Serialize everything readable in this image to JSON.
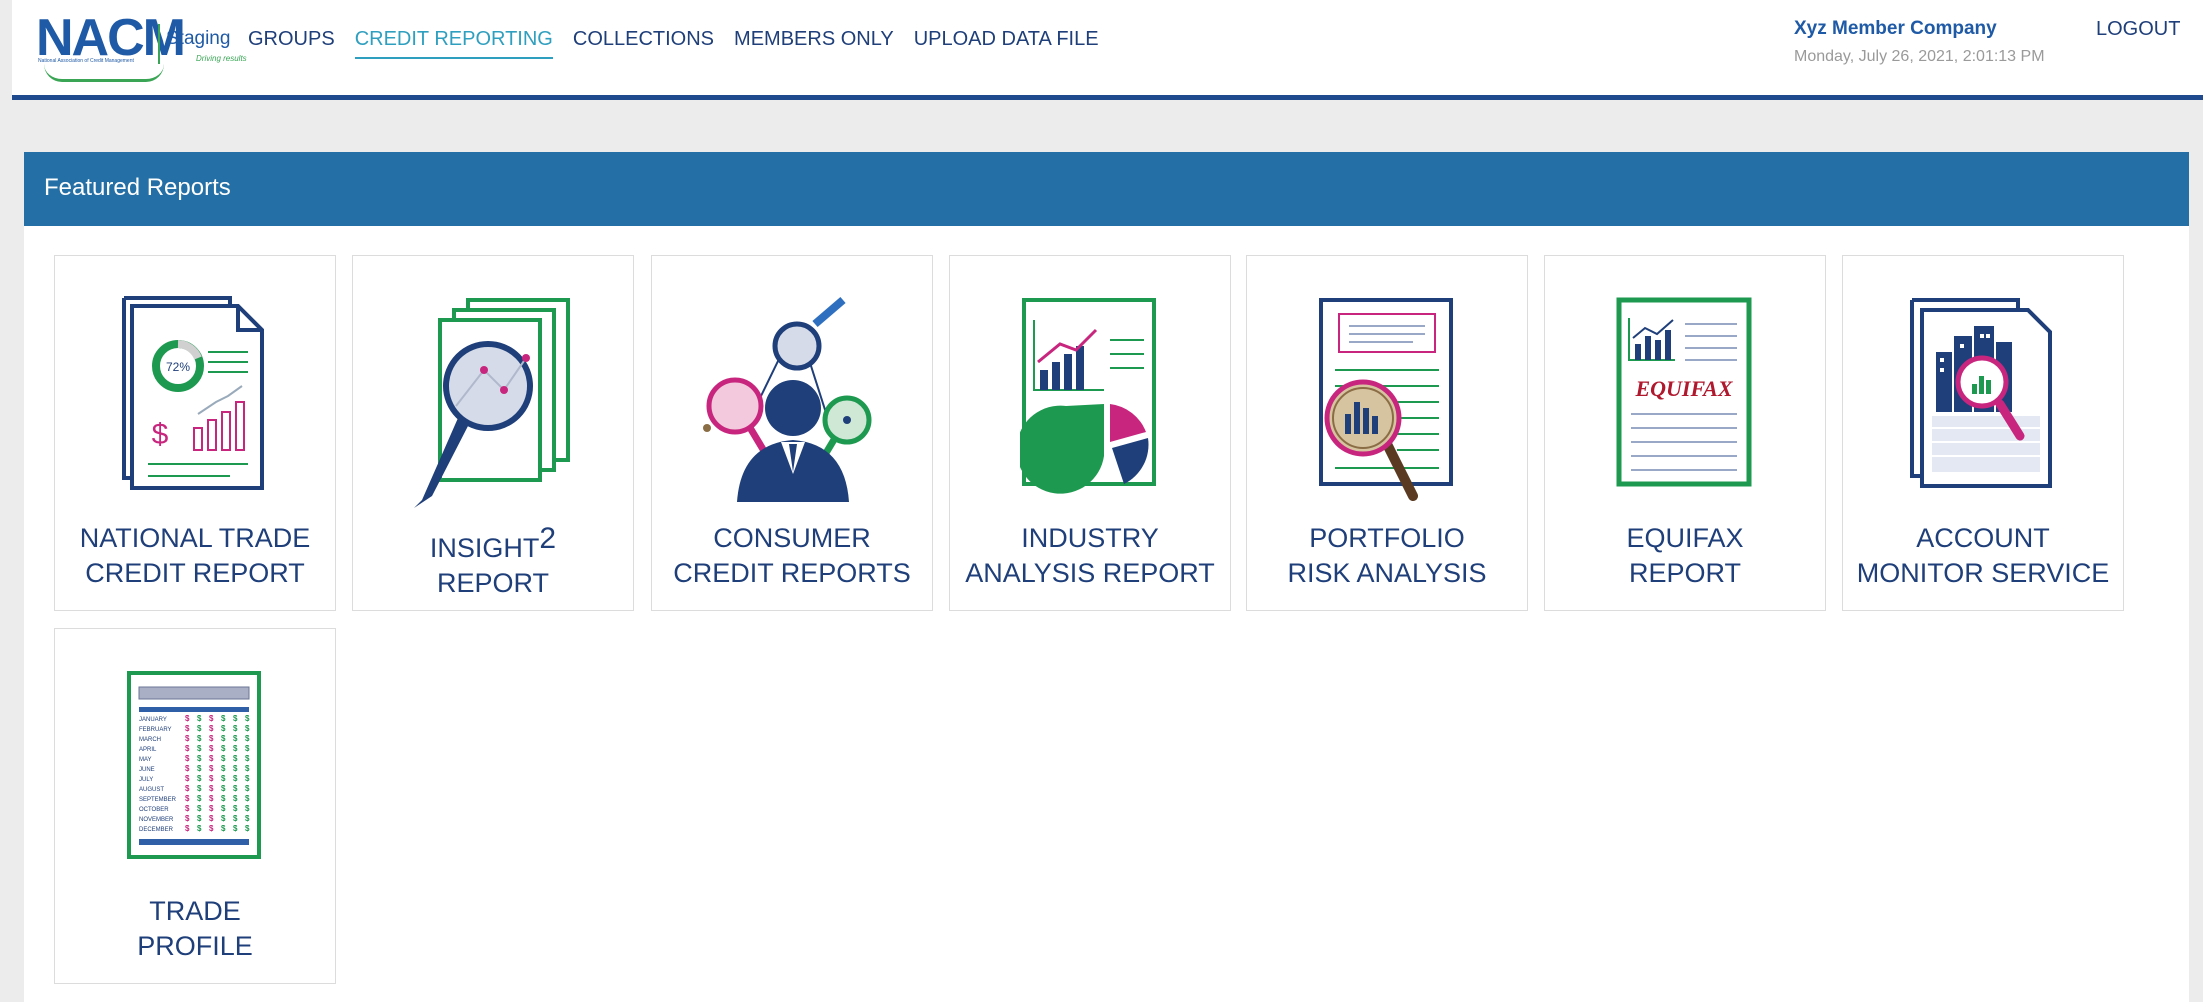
{
  "brand": {
    "logo_text": "NACM",
    "logo_subtext": "National Association of Credit Management",
    "environment": "Staging",
    "tagline": "Driving results"
  },
  "nav": [
    {
      "label": "GROUPS",
      "active": false
    },
    {
      "label": "CREDIT REPORTING",
      "active": true
    },
    {
      "label": "COLLECTIONS",
      "active": false
    },
    {
      "label": "MEMBERS ONLY",
      "active": false
    },
    {
      "label": "UPLOAD DATA FILE",
      "active": false
    }
  ],
  "user": {
    "company": "Xyz Member Company",
    "datetime": "Monday, July 26, 2021, 2:01:13 PM",
    "logout_label": "LOGOUT"
  },
  "panel": {
    "title": "Featured Reports"
  },
  "reports": [
    {
      "icon": "trade-report-icon",
      "line1": "NATIONAL TRADE",
      "line2": "CREDIT REPORT",
      "doc_text": "72%",
      "doc_dollar": "$"
    },
    {
      "icon": "insight-magnifier-icon",
      "line1": "INSIGHT",
      "sup": "2",
      "line2": "REPORT"
    },
    {
      "icon": "consumer-person-icon",
      "line1": "CONSUMER",
      "line2": "CREDIT REPORTS"
    },
    {
      "icon": "industry-chart-icon",
      "line1": "INDUSTRY",
      "line2": "ANALYSIS REPORT"
    },
    {
      "icon": "portfolio-magnifier-icon",
      "line1": "PORTFOLIO",
      "line2": "RISK ANALYSIS"
    },
    {
      "icon": "equifax-doc-icon",
      "line1": "EQUIFAX",
      "line2": "REPORT",
      "doc_text": "EQUIFAX"
    },
    {
      "icon": "account-monitor-icon",
      "line1": "ACCOUNT",
      "line2": "MONITOR SERVICE"
    },
    {
      "icon": "trade-profile-icon",
      "line1": "TRADE",
      "line2": "PROFILE",
      "months": [
        "JANUARY",
        "FEBRUARY",
        "MARCH",
        "APRIL",
        "MAY",
        "JUNE",
        "JULY",
        "AUGUST",
        "SEPTEMBER",
        "OCTOBER",
        "NOVEMBER",
        "DECEMBER"
      ],
      "dollar": "$"
    }
  ],
  "colors": {
    "navy": "#1f3f7a",
    "green": "#1e9a50",
    "magenta": "#c8267e",
    "header_blue": "#2470a6",
    "active_teal": "#2f9fbf"
  }
}
